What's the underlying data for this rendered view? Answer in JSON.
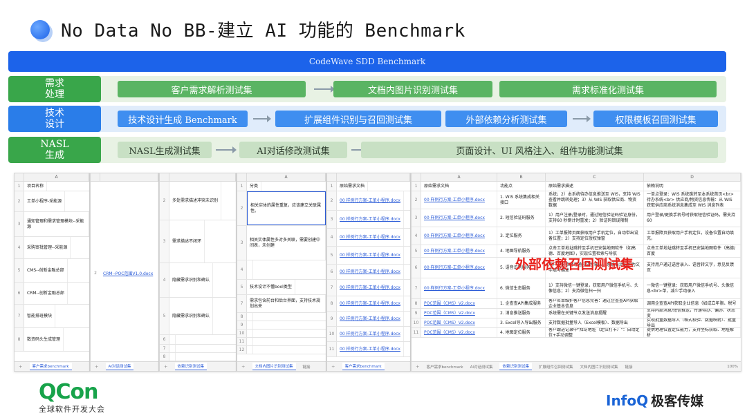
{
  "title": "No Data No BB-建立 AI 功能的 Benchmark",
  "banner": "CodeWave SDD Benchmark",
  "rows": [
    {
      "label": "需求\n处理",
      "boxes": [
        "客户需求解析测试集",
        "文档内图片识别测试集",
        "需求标准化测试集"
      ]
    },
    {
      "label": "技术\n设计",
      "boxes": [
        "技术设计生成 Benchmark",
        "扩展组件识别与召回测试集",
        "外部依赖分析测试集",
        "权限模板召回测试集"
      ]
    },
    {
      "label": "NASL\n生成",
      "boxes": [
        "NASL生成测试集",
        "AI对话修改测试集",
        "页面设计、UI 风格注入、组件功能测试集"
      ]
    }
  ],
  "sheets": {
    "s1": {
      "col": "A",
      "rows": [
        [
          "1",
          "项目名称"
        ],
        [
          "2",
          "工单小程序-采能源"
        ],
        [
          "3",
          "通知管理和需求管理模块--采能源"
        ],
        [
          "4",
          "采购审批管理--采能源"
        ],
        [
          "5",
          "CMS--创新金融总部"
        ],
        [
          "6",
          "CRM--创新金融总部"
        ],
        [
          "7",
          "智能排班模块"
        ],
        [
          "8",
          "数资码头生成管理"
        ]
      ],
      "tabs": [
        "客户需求benchmark"
      ]
    },
    "s2": {
      "cells": [
        "2",
        "CRM--POC范围V1.0.docx"
      ],
      "tabs": [
        "AI对话测试集"
      ]
    },
    "s3": {
      "rows": [
        [
          "2",
          "多处需求描述冲突未识别"
        ],
        [
          "3",
          "需求描述不闭环"
        ],
        [
          "4",
          "隐藏需求识别和确认"
        ],
        [
          "5",
          "隐藏需求识别和确认"
        ],
        [
          "6",
          ""
        ],
        [
          "7",
          ""
        ],
        [
          "8",
          ""
        ]
      ],
      "tabs": [
        "依赖识别测试集"
      ]
    },
    "s4": {
      "col": "A",
      "rows": [
        [
          "1",
          "分类"
        ],
        [
          "2",
          "相关实体的属性重复，应该建立关联属性。"
        ],
        [
          "3",
          "相关实体属性多对多关联，需要创建中间表，未创建"
        ],
        [
          "4",
          ""
        ],
        [
          "5",
          "技术设计不懂bool类型"
        ],
        [
          "7",
          "需求包含前台和后台界面，支持技术规划出来"
        ],
        [
          "8",
          ""
        ],
        [
          "9",
          ""
        ],
        [
          "10",
          ""
        ],
        [
          "11",
          ""
        ],
        [
          "12",
          ""
        ],
        [
          "13",
          ""
        ]
      ],
      "tabs": [
        "文档内图片识别测试集",
        "链接"
      ]
    },
    "s5": {
      "header": "原始需求文档",
      "rows": [
        [
          "1",
          "原始需求文档"
        ],
        [
          "2",
          "00 样例行方案-工单小程序.docx"
        ],
        [
          "3",
          "00 样例行方案-工单小程序.docx"
        ],
        [
          "4",
          "00 样例行方案-工单小程序.docx"
        ],
        [
          "5",
          "00 样例行方案-工单小程序.docx"
        ],
        [
          "6",
          "00 样例行方案-工单小程序.docx"
        ],
        [
          "7",
          "00 样例行方案-工单小程序.docx"
        ],
        [
          "8",
          "00 样例行方案-工单小程序.docx"
        ],
        [
          "9",
          "00 样例行方案-工单小程序.docx"
        ],
        [
          "10",
          "00 样例行方案-工单小程序.docx"
        ],
        [
          "11",
          "00 样例行方案-工单小程序.docx"
        ]
      ],
      "tabs": [
        "客户需求benchmark"
      ]
    },
    "s6": {
      "headers": [
        "原始需求文档",
        "功能点",
        "原始需求描述",
        "依赖说明"
      ],
      "rows": [
        [
          "1",
          "原始需求文档",
          "功能点",
          "原始需求描述",
          "依赖说明"
        ],
        [
          "2",
          "00 样例行方案-工单小程序.docx",
          "1. WIS 系统集成相关接口",
          "系统；2）本系统待办信息推送至 WIS，支持 WIS 查看并跳转处理；3）从 WIS 获取供应商、物资数据",
          "一单点登录：WIS 系统跳转至本系统首页<br> 待办系统<br> 供应商/物资信息传输：从 WIS 获取供应商系统消息集成至 WIS 消息列表"
        ],
        [
          "3",
          "00 样例行方案-工单小程序.docx",
          "2. 短信验证码服务",
          "1）用户注册/登录时，通过短信验证码验证身份，支持60 秒倒计时重发；2）验证码错误限制",
          "用户登录/更换手机号时获取短信验证码，需支持 60"
        ],
        [
          "4",
          "00 样例行方案-工单小程序.docx",
          "3. 定位服务",
          "1）工单报障页面获取用户手机定位，自动带出设备位置；2）支持定位授权弹窗",
          "工单报障页获取用户手机定位，设备位置自动填充，"
        ],
        [
          "5",
          "00 样例行方案-工单小程序.docx",
          "4. 地图导航服务",
          "点击工单地址跳转至手机已安装地图软件（如高德、百度地图），实现位置检索与导航",
          "点击工单地址跳转至手机已安装地图软件（高德/百度"
        ],
        [
          "6",
          "00 样例行方案-工单小程序.docx",
          "5. 语音识别服务",
          "用户在报修时可通过语音输入，系统自动识别为文字填写描述",
          "支持用户通过语音录入、语音转文字，意见反馈页"
        ],
        [
          "7",
          "00 样例行方案-工单小程序.docx",
          "6. 微信生态服务",
          "1）支持微信一键登录，获取用户微信手机号、头像信息；2）支持微信扫一扫",
          "一微信一键登录：获取用户微信手机号、头像信息<br>单，减少手动录入"
        ],
        [
          "8",
          "POC范围（CMS）V2.docx",
          "1. 企查查API集成服务",
          "客户名单维护客户信息完善：通过企查查API获取企业基本信息",
          "调用企查查API获取企业信息（如成立年限、税号"
        ],
        [
          "9",
          "POC范围（CMS）V2.docx",
          "2. 消息推送服务",
          "系统需在关键节点发送消息提醒",
          "支持内部消息/短信推送，传递待办、偏办、状态变"
        ],
        [
          "10",
          "POC范围（CMS）V2.docx",
          "3. Excel导入导出服务",
          "支持数据批量导入（Excel模板）、数据导出",
          "实现批量数据导入（格式校验、数据映射）、批量导出"
        ],
        [
          "11",
          "POC范围（CMS）V2.docx",
          "4. 地图定位服务",
          "客户跟进记录中\"拜访地址（定位打卡）\"：自动定位+手动调整",
          "提供地理位置定位能力，支持坐标获取、地址解析"
        ]
      ],
      "tabs": [
        "客户需求benchmark",
        "AI对话测试集",
        "依赖识别测试集",
        "扩展组件召回测试集",
        "文档内图片识别测试集",
        "链接"
      ],
      "zoom": "100%"
    }
  },
  "overlay": "外部依赖召回测试集",
  "footer": {
    "qcon": "QCon",
    "qcon_sub": "全球软件开发大会",
    "infoq": "InfoQ",
    "infoq_cn": "极客传媒"
  }
}
